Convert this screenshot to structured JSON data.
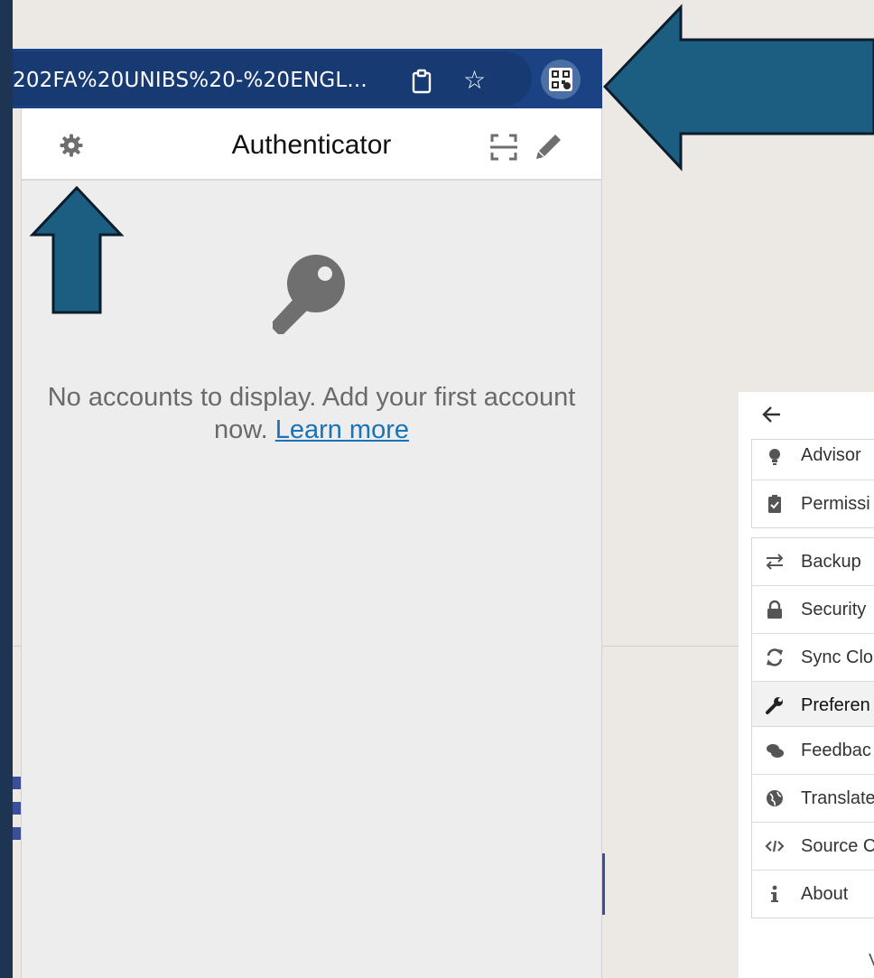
{
  "browser": {
    "url_text": "202FA%20UNIBS%20-%20ENGL...",
    "icons": [
      "clipboard-icon",
      "star-icon",
      "qr-extension-icon"
    ]
  },
  "popup": {
    "title": "Authenticator",
    "empty_message": "No accounts to display. Add your first account now.",
    "learn_more": "Learn more",
    "icons": [
      "gear-icon",
      "scan-qr-icon",
      "pencil-icon",
      "key-icon"
    ]
  },
  "settings": {
    "back_icon": "back-arrow-icon",
    "groups": [
      [
        {
          "label": "Advisor",
          "icon": "lightbulb-icon"
        },
        {
          "label": "Permissi",
          "icon": "clipboard-check-icon"
        }
      ],
      [
        {
          "label": "Backup",
          "icon": "swap-arrows-icon"
        },
        {
          "label": "Security",
          "icon": "lock-icon"
        },
        {
          "label": "Sync Clo",
          "icon": "sync-icon"
        },
        {
          "label": "Preferen",
          "icon": "wrench-icon"
        }
      ],
      [
        {
          "label": "Feedbac",
          "icon": "comments-icon"
        },
        {
          "label": "Translate",
          "icon": "globe-icon"
        },
        {
          "label": "Source C",
          "icon": "code-icon"
        },
        {
          "label": "About",
          "icon": "info-icon"
        }
      ]
    ],
    "version_fragment": "V"
  },
  "colors": {
    "arrow_fill": "#1b5e82",
    "arrow_stroke": "#0b1c2c",
    "address_bar": "#1b4282",
    "background": "#ece9e5",
    "link": "#1a73b8"
  }
}
